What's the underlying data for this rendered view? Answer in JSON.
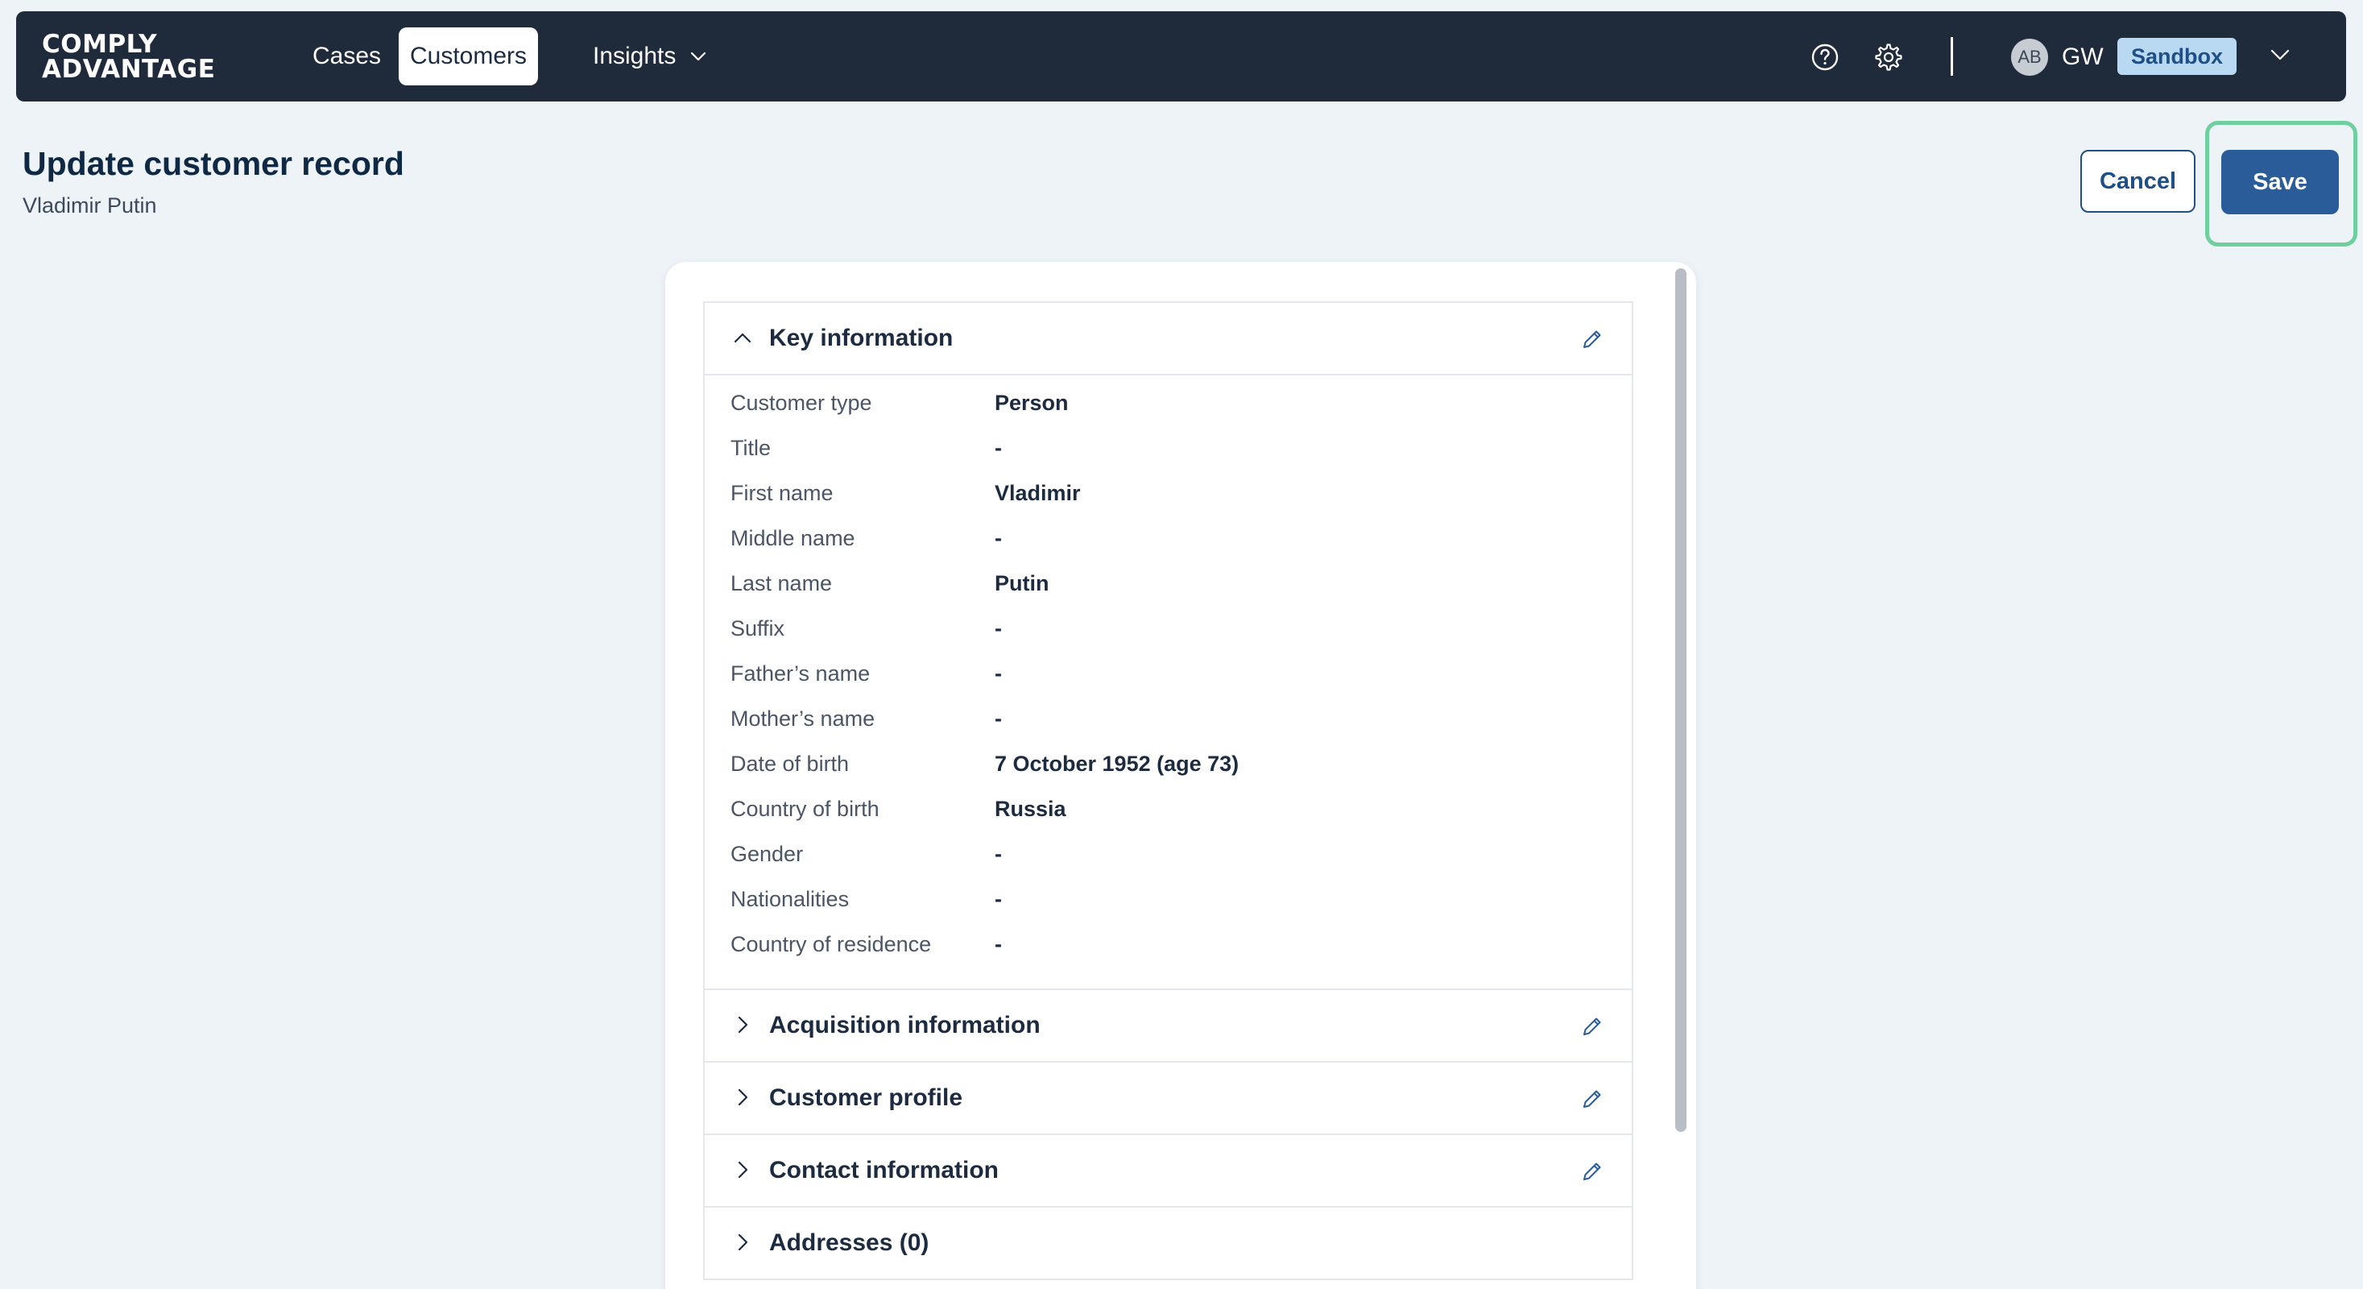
{
  "nav": {
    "logo_line1": "COMPLY",
    "logo_line2": "ADVANTAGE",
    "items": [
      {
        "label": "Cases"
      },
      {
        "label": "Customers"
      },
      {
        "label": "Insights"
      }
    ],
    "avatar_initials": "AB",
    "user_initials": "GW",
    "environment_badge": "Sandbox"
  },
  "page": {
    "title": "Update customer record",
    "subtitle": "Vladimir Putin",
    "cancel_label": "Cancel",
    "save_label": "Save"
  },
  "sections": {
    "key_information": {
      "title": "Key information",
      "fields": [
        {
          "label": "Customer type",
          "value": "Person"
        },
        {
          "label": "Title",
          "value": "-"
        },
        {
          "label": "First name",
          "value": "Vladimir"
        },
        {
          "label": "Middle name",
          "value": "-"
        },
        {
          "label": "Last name",
          "value": "Putin"
        },
        {
          "label": "Suffix",
          "value": "-"
        },
        {
          "label": "Father’s name",
          "value": "-"
        },
        {
          "label": "Mother’s name",
          "value": "-"
        },
        {
          "label": "Date of birth",
          "value": "7 October 1952 (age 73)"
        },
        {
          "label": "Country of birth",
          "value": "Russia"
        },
        {
          "label": "Gender",
          "value": "-"
        },
        {
          "label": "Nationalities",
          "value": "-"
        },
        {
          "label": "Country of residence",
          "value": "-"
        }
      ]
    },
    "acquisition_information": {
      "title": "Acquisition information"
    },
    "customer_profile": {
      "title": "Customer profile"
    },
    "contact_information": {
      "title": "Contact information"
    },
    "addresses": {
      "title": "Addresses (0)"
    }
  },
  "icons": {
    "help": "help-circle-icon",
    "settings": "gear-icon",
    "edit": "pencil-icon",
    "expand": "chevron-right-icon",
    "collapse": "chevron-up-icon",
    "dropdown": "chevron-down-icon"
  },
  "colors": {
    "nav_background": "#1f2a3a",
    "primary": "#2a5c9a",
    "highlight": "#6fcf9f",
    "badge_background": "#b9d9f2",
    "page_background": "#eef3f8"
  }
}
